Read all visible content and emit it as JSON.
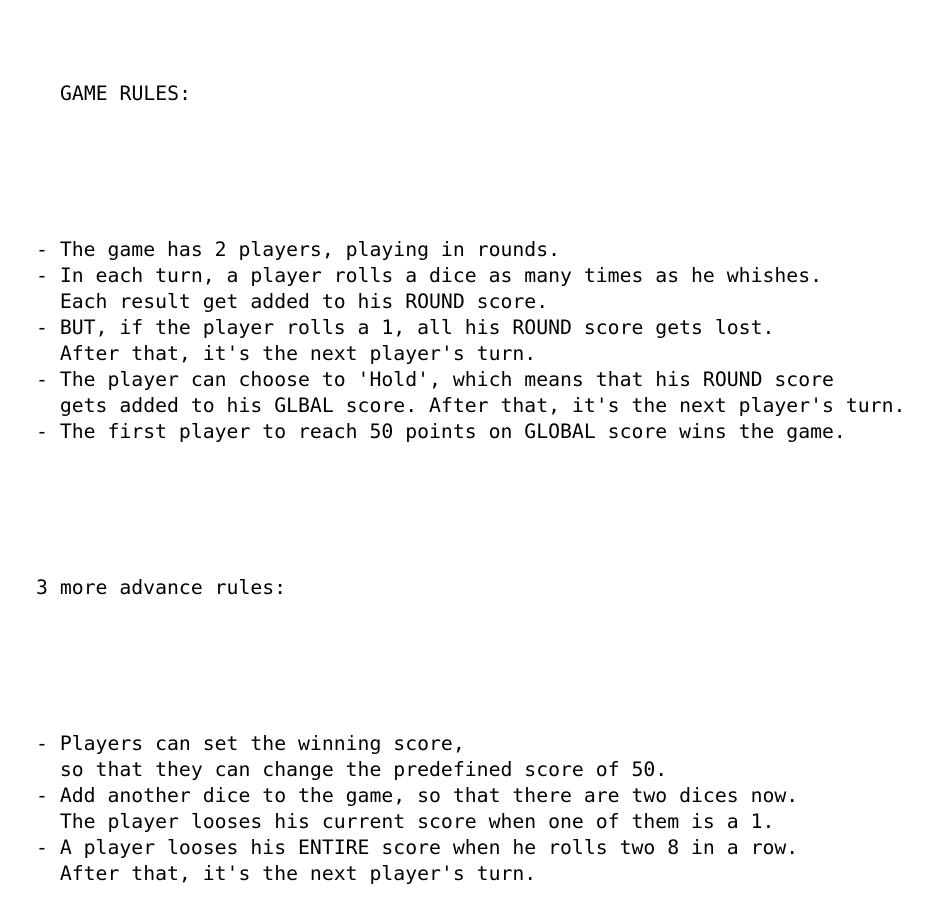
{
  "title": "GAME RULES:",
  "basic_rules": [
    {
      "bullet": "- ",
      "lines": [
        "The game has 2 players, playing in rounds."
      ]
    },
    {
      "bullet": "- ",
      "lines": [
        "In each turn, a player rolls a dice as many times as he whishes.",
        "Each result get added to his ROUND score."
      ]
    },
    {
      "bullet": "- ",
      "lines": [
        "BUT, if the player rolls a 1, all his ROUND score gets lost.",
        "After that, it's the next player's turn."
      ]
    },
    {
      "bullet": "- ",
      "lines": [
        "The player can choose to 'Hold', which means that his ROUND score",
        "gets added to his GLBAL score. After that, it's the next player's turn."
      ]
    },
    {
      "bullet": "- ",
      "lines": [
        "The first player to reach 50 points on GLOBAL score wins the game."
      ]
    }
  ],
  "advanced_heading": "3 more advance rules:",
  "advanced_rules": [
    {
      "bullet": "- ",
      "lines": [
        "Players can set the winning score,",
        "so that they can change the predefined score of 50."
      ]
    },
    {
      "bullet": "- ",
      "lines": [
        "Add another dice to the game, so that there are two dices now.",
        "The player looses his current score when one of them is a 1."
      ]
    },
    {
      "bullet": "- ",
      "lines": [
        "A player looses his ENTIRE score when he rolls two 8 in a row.",
        "After that, it's the next player's turn."
      ]
    }
  ]
}
